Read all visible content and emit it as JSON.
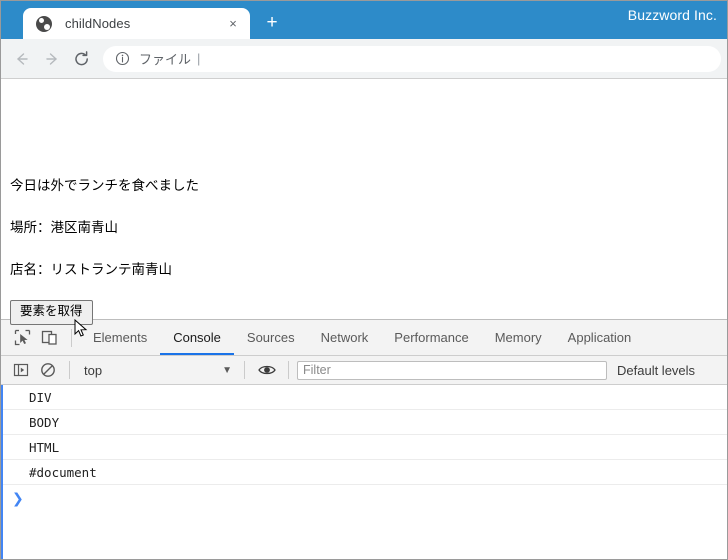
{
  "browser": {
    "brand": "Buzzword Inc.",
    "tab": {
      "title": "childNodes",
      "favicon": "globe-icon",
      "close": "×"
    },
    "new_tab": "+",
    "nav": {
      "back": "back-arrow-icon",
      "forward": "forward-arrow-icon",
      "reload": "reload-icon"
    },
    "omnibox": {
      "info_icon": "info-circle-icon",
      "text": "ファイル",
      "separator": "|"
    },
    "accent_color": "#2d8bc9"
  },
  "page": {
    "paragraphs": [
      "今日は外でランチを食べました",
      "場所：港区南青山",
      "店名：リストランテ南青山"
    ],
    "button_label": "要素を取得"
  },
  "devtools": {
    "inspect_icon": "inspect-element-icon",
    "device_icon": "device-toolbar-icon",
    "tabs": [
      {
        "label": "Elements",
        "active": false
      },
      {
        "label": "Console",
        "active": true
      },
      {
        "label": "Sources",
        "active": false
      },
      {
        "label": "Network",
        "active": false
      },
      {
        "label": "Performance",
        "active": false
      },
      {
        "label": "Memory",
        "active": false
      },
      {
        "label": "Application",
        "active": false
      }
    ],
    "console_toolbar": {
      "sidebar_icon": "console-sidebar-icon",
      "clear_icon": "clear-console-icon",
      "context": "top",
      "context_arrow": "▼",
      "eye_icon": "live-expression-icon",
      "filter_placeholder": "Filter",
      "levels_label": "Default levels"
    },
    "console_messages": [
      "DIV",
      "BODY",
      "HTML",
      "#document"
    ],
    "prompt": "❯",
    "active_tab_underline_color": "#1a73e8"
  }
}
